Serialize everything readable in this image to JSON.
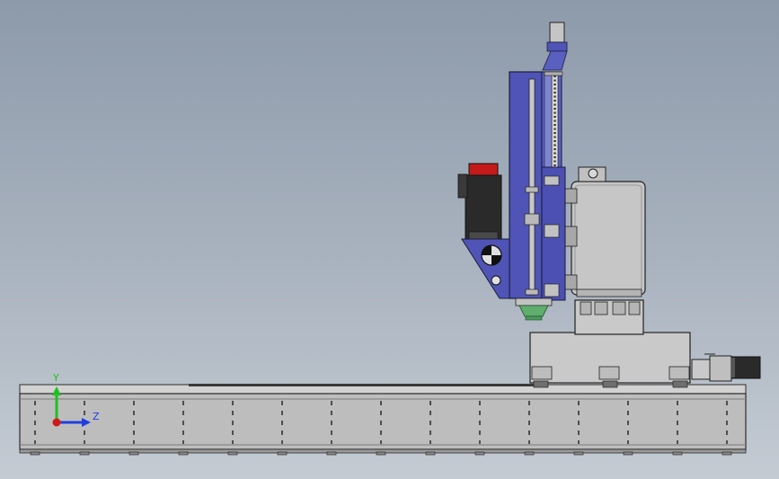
{
  "viewport": {
    "background_top": "#8d9aaa",
    "background_bottom": "#c4cbd3"
  },
  "triad": {
    "y_label": "Y",
    "z_label": "Z",
    "y_color": "#1ec01e",
    "z_color": "#1f3ee0",
    "x_color": "#d01818"
  },
  "colors": {
    "column_blue": "#4f54b6",
    "body_gray": "#c6c6c6",
    "base_gray": "#bdbdbd",
    "motor_black": "#2a2a2a",
    "motor_red": "#c41a1a",
    "green_fitting": "#5fae6e"
  },
  "icons": [
    "triad-icon"
  ]
}
